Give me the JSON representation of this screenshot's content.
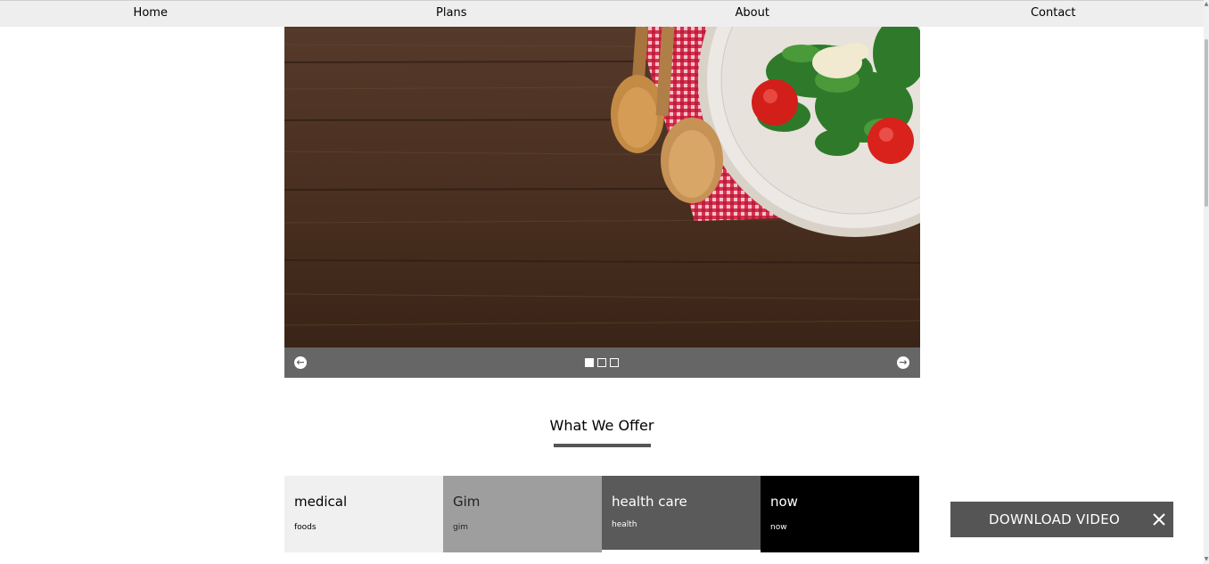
{
  "nav": {
    "items": [
      "Home",
      "Plans",
      "About",
      "Contact"
    ]
  },
  "slider": {
    "image_icon": "salad-on-wooden-table-photo",
    "prev_icon": "arrow-left-circle-icon",
    "next_icon": "arrow-right-circle-icon",
    "slide_count": 3,
    "active_slide": 1
  },
  "section": {
    "title": "What We Offer"
  },
  "cards": [
    {
      "title": "medical",
      "subtitle": "foods"
    },
    {
      "title": "Gim",
      "subtitle": "gim"
    },
    {
      "title": "health care",
      "subtitle": "health"
    },
    {
      "title": "now",
      "subtitle": "now"
    }
  ],
  "download_banner": {
    "label": "DOWNLOAD VIDEO",
    "close_icon": "close-icon"
  },
  "colors": {
    "nav_bg": "#eeeeee",
    "slider_bar": "#666666",
    "card_1": "#f0f0f0",
    "card_2": "#9e9e9e",
    "card_3": "#5a5a5a",
    "card_4": "#000000",
    "banner": "#555555"
  }
}
